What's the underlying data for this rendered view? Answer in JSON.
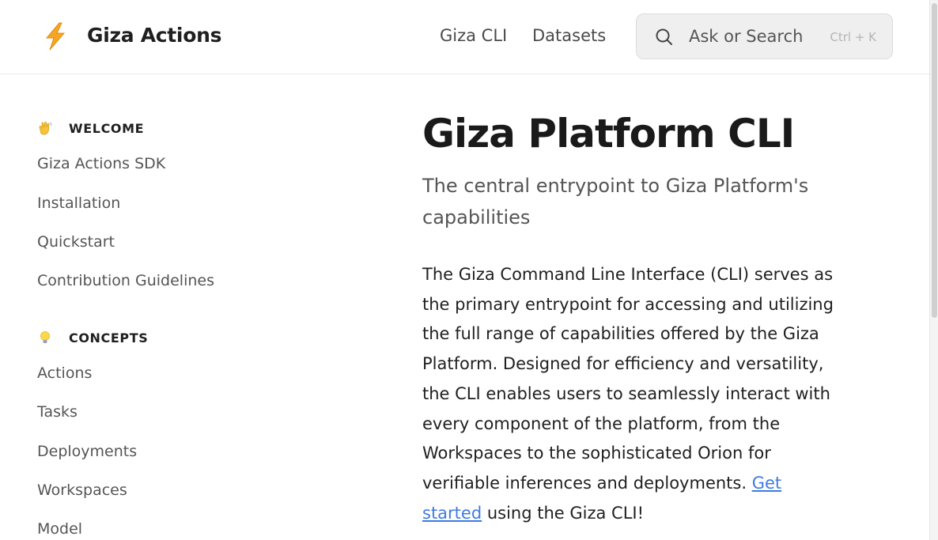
{
  "header": {
    "brand": "Giza Actions",
    "logo_icon": "lightning-bolt-icon",
    "nav": [
      {
        "label": "Giza CLI"
      },
      {
        "label": "Datasets"
      }
    ],
    "search": {
      "placeholder": "Ask or Search",
      "shortcut": "Ctrl + K",
      "icon": "search-icon"
    }
  },
  "sidebar": {
    "sections": [
      {
        "emoji_icon": "waving-hand-icon",
        "title": "WELCOME",
        "items": [
          "Giza Actions SDK",
          "Installation",
          "Quickstart",
          "Contribution Guidelines"
        ]
      },
      {
        "emoji_icon": "light-bulb-icon",
        "title": "CONCEPTS",
        "items": [
          "Actions",
          "Tasks",
          "Deployments",
          "Workspaces",
          "Model"
        ]
      }
    ]
  },
  "content": {
    "title": "Giza Platform CLI",
    "subtitle": "The central entrypoint to Giza Platform's capabilities",
    "body_before_link": "The Giza Command Line Interface (CLI) serves as the primary entrypoint for accessing and utilizing the full range of capabilities offered by the Giza Platform. Designed for efficiency and versatility, the CLI enables users to seamlessly interact with every component of the platform, from the Workspaces to the sophisticated Orion for verifiable inferences and deployments. ",
    "link_text": "Get started",
    "body_after_link": " using the Giza CLI!"
  },
  "colors": {
    "accent_link": "#3f7be0",
    "bolt": "#f5a623"
  }
}
